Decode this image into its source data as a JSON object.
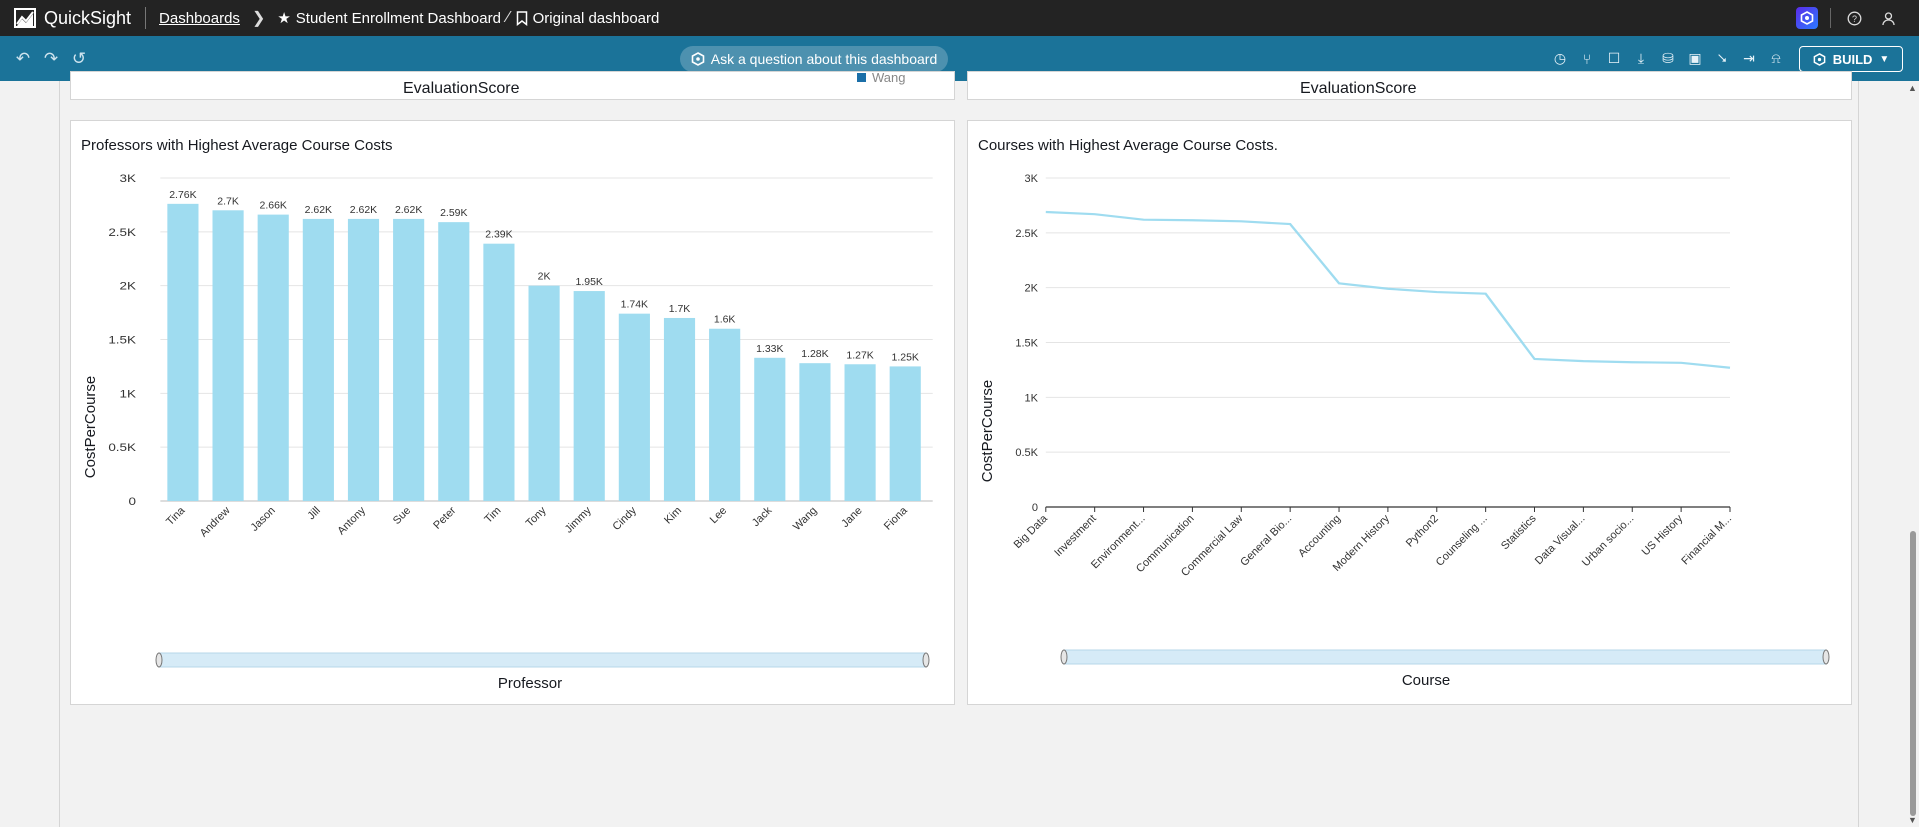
{
  "app": {
    "name": "QuickSight"
  },
  "breadcrumb": {
    "root": "Dashboards",
    "dashboard": "Student Enrollment Dashboard",
    "sheet": "Original dashboard"
  },
  "toolbar": {
    "ask_label": "Ask a question about this dashboard",
    "build_label": "BUILD"
  },
  "partial_visuals": {
    "left_axis_label": "EvaluationScore",
    "left_legend_item": "Wang",
    "right_axis_label": "EvaluationScore"
  },
  "visuals": [
    {
      "title": "Professors with Highest Average Course Costs",
      "xlabel": "Professor",
      "ylabel": "CostPerCourse"
    },
    {
      "title": "Courses with Highest Average Course Costs.",
      "xlabel": "Course",
      "ylabel": "CostPerCourse"
    }
  ],
  "chart_data": [
    {
      "type": "bar",
      "title": "Professors with Highest Average Course Costs",
      "xlabel": "Professor",
      "ylabel": "CostPerCourse",
      "ylim": [
        0,
        3000
      ],
      "yticks": [
        "0",
        "0.5K",
        "1K",
        "1.5K",
        "2K",
        "2.5K",
        "3K"
      ],
      "categories": [
        "Tina",
        "Andrew",
        "Jason",
        "Jill",
        "Antony",
        "Sue",
        "Peter",
        "Tim",
        "Tony",
        "Jimmy",
        "Cindy",
        "Kim",
        "Lee",
        "Jack",
        "Wang",
        "Jane",
        "Fiona"
      ],
      "values": [
        2760,
        2700,
        2660,
        2620,
        2620,
        2620,
        2590,
        2390,
        2000,
        1950,
        1740,
        1700,
        1600,
        1330,
        1280,
        1270,
        1250
      ],
      "data_labels": [
        "2.76K",
        "2.7K",
        "2.66K",
        "2.62K",
        "2.62K",
        "2.62K",
        "2.59K",
        "2.39K",
        "2K",
        "1.95K",
        "1.74K",
        "1.7K",
        "1.6K",
        "1.33K",
        "1.28K",
        "1.27K",
        "1.25K"
      ],
      "color": "#9fdcf0",
      "grid": true
    },
    {
      "type": "line",
      "title": "Courses with Highest Average Course Costs.",
      "xlabel": "Course",
      "ylabel": "CostPerCourse",
      "ylim": [
        0,
        3000
      ],
      "yticks": [
        "0",
        "0.5K",
        "1K",
        "1.5K",
        "2K",
        "2.5K",
        "3K"
      ],
      "categories": [
        "Big Data",
        "Investment",
        "Environment...",
        "Communication",
        "Commercial Law",
        "General Bio...",
        "Accounting",
        "Modern History",
        "Python2",
        "Counseling ...",
        "Statistics",
        "Data Visual...",
        "Urban socio...",
        "US History",
        "Financial M..."
      ],
      "values": [
        2690,
        2670,
        2620,
        2615,
        2605,
        2580,
        2040,
        1990,
        1960,
        1945,
        1350,
        1330,
        1320,
        1315,
        1270
      ],
      "color": "#9fdcf0",
      "grid": true
    }
  ]
}
